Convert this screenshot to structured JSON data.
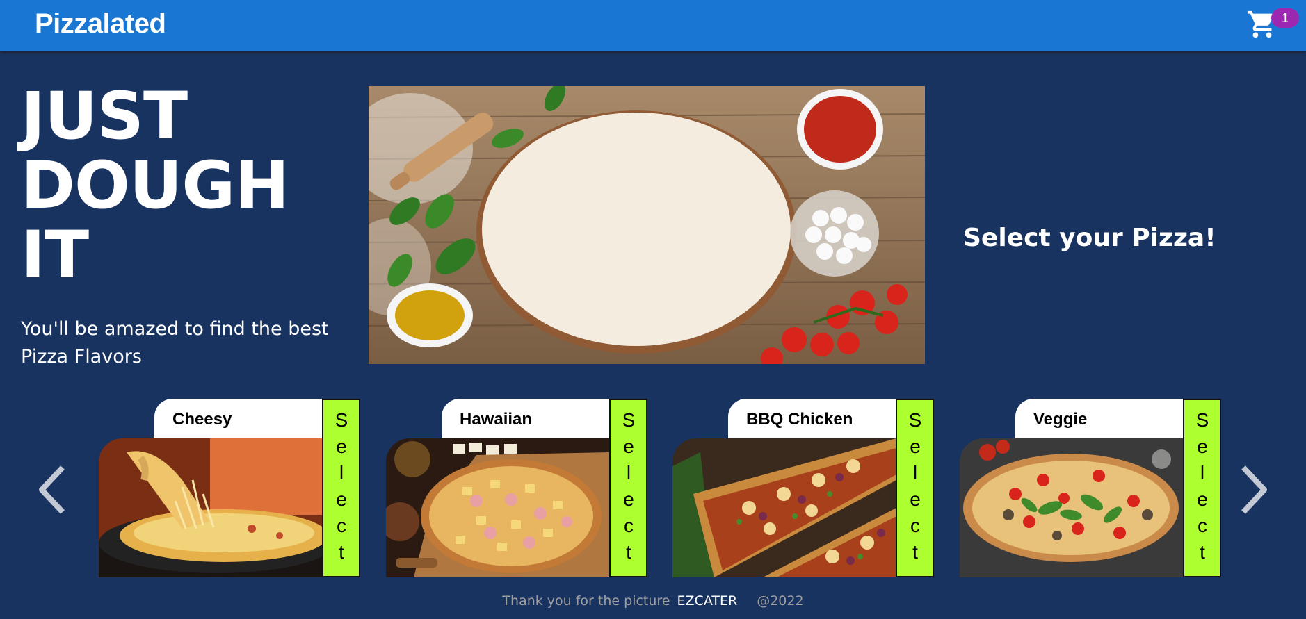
{
  "app": {
    "brand": "Pizzalated"
  },
  "cart": {
    "count": "1",
    "icon": "shopping-cart-icon"
  },
  "hero": {
    "title": "JUST DOUGH IT",
    "subtitle": "You'll be amazed to find the best Pizza Flavors",
    "image_icon": "pizza-dough-photo"
  },
  "select_prompt": "Select your Pizza!",
  "carousel": {
    "prev_icon": "chevron-left-icon",
    "next_icon": "chevron-right-icon",
    "items": [
      {
        "name": "Cheesy",
        "select_label": "Select",
        "image_icon": "cheesy-pizza-photo"
      },
      {
        "name": "Hawaiian",
        "select_label": "Select",
        "image_icon": "hawaiian-pizza-photo"
      },
      {
        "name": "BBQ Chicken",
        "select_label": "Select",
        "image_icon": "bbq-chicken-pizza-photo"
      },
      {
        "name": "Veggie",
        "select_label": "Select",
        "image_icon": "veggie-pizza-photo"
      }
    ]
  },
  "footer": {
    "thanks_text": "Thank you for the picture",
    "credit_link": "EZCATER",
    "copyright": "@2022"
  },
  "colors": {
    "navbar": "#1976d2",
    "background": "#193360",
    "select_button": "#adff2f",
    "badge": "#9c27b0"
  }
}
